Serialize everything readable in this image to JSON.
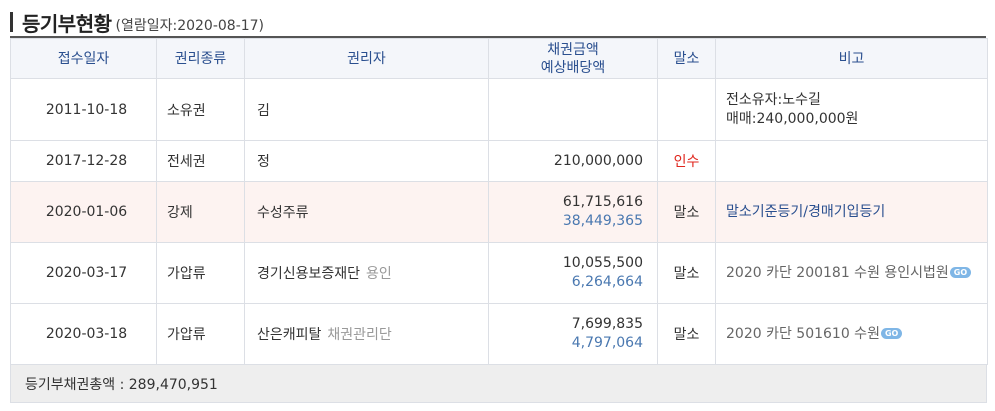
{
  "header": {
    "title": "등기부현황",
    "date_label": "(열람일자:2020-08-17)"
  },
  "columns": {
    "date": "접수일자",
    "type": "권리종류",
    "holder": "권리자",
    "amount_line1": "채권금액",
    "amount_line2": "예상배당액",
    "malso": "말소",
    "note": "비고"
  },
  "rows": [
    {
      "date": "2011-10-18",
      "type": "소유권",
      "holder": "김",
      "holder_sub": "",
      "amount": "",
      "dividend": "",
      "malso": "",
      "note_line1": "전소유자:노수길",
      "note_line2": "매매:240,000,000원"
    },
    {
      "date": "2017-12-28",
      "type": "전세권",
      "holder": "정",
      "holder_sub": "",
      "amount": "210,000,000",
      "dividend": "",
      "malso": "인수",
      "note_line1": ""
    },
    {
      "date": "2020-01-06",
      "type": "강제",
      "holder": "수성주류",
      "holder_sub": "",
      "amount": "61,715,616",
      "dividend": "38,449,365",
      "malso": "말소",
      "note_line1": "말소기준등기/경매기입등기"
    },
    {
      "date": "2020-03-17",
      "type": "가압류",
      "holder": "경기신용보증재단",
      "holder_sub": "용인",
      "amount": "10,055,500",
      "dividend": "6,264,664",
      "malso": "말소",
      "note_line1": "2020 카단 200181 수원 용인시법원",
      "go_label": "GO"
    },
    {
      "date": "2020-03-18",
      "type": "가압류",
      "holder": "산은캐피탈",
      "holder_sub": "채권관리단",
      "amount": "7,699,835",
      "dividend": "4,797,064",
      "malso": "말소",
      "note_line1": "2020 카단 501610 수원",
      "go_label": "GO"
    }
  ],
  "footer": {
    "total": "등기부채권총액 : 289,470,951"
  },
  "colors": {
    "header_text": "#2a4f8f",
    "highlight_row": "#fdf3f1",
    "red": "#e0261d",
    "blue": "#4a78b0",
    "go_badge": "#7fb6e6"
  }
}
